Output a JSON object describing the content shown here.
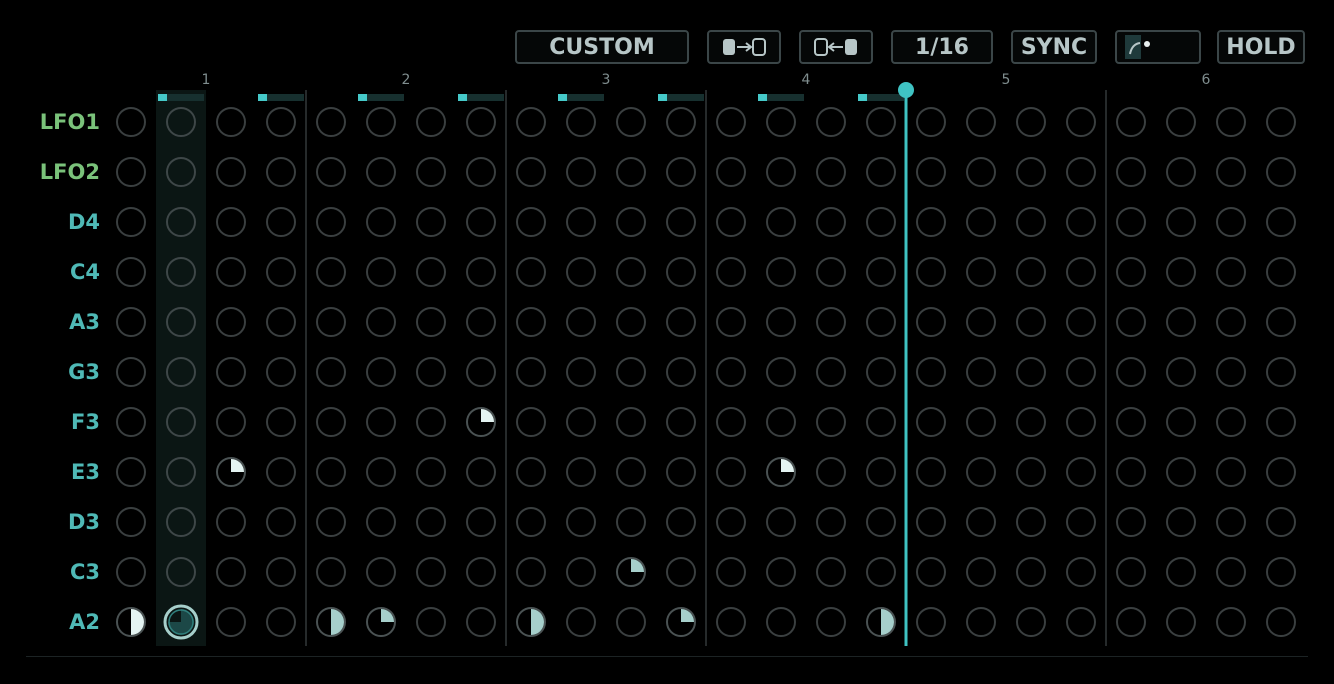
{
  "toolbar": {
    "mode_label": "CUSTOM",
    "shift_right_icon": "shift-right-icon",
    "shift_left_icon": "shift-left-icon",
    "rate_label": "1/16",
    "sync_label": "SYNC",
    "curve_icon": "curve-knob-icon",
    "hold_label": "HOLD"
  },
  "colors": {
    "background": "#000000",
    "lfo_label": "#7ac27a",
    "note_label": "#4fb9b6",
    "accent": "#45c9c9",
    "circle_stroke": "#3a3f40",
    "fill_light": "#e4f4f2",
    "fill_mid": "#a6cfcb",
    "fill_dark": "#1c4847",
    "bar_track": "#17302f",
    "playhead": "#3fc3c3"
  },
  "beats": [
    "1",
    "2",
    "3",
    "4",
    "5",
    "6"
  ],
  "rows": [
    {
      "label": "LFO1",
      "kind": "lfo"
    },
    {
      "label": "LFO2",
      "kind": "lfo"
    },
    {
      "label": "D4",
      "kind": "note"
    },
    {
      "label": "C4",
      "kind": "note"
    },
    {
      "label": "A3",
      "kind": "note"
    },
    {
      "label": "G3",
      "kind": "note"
    },
    {
      "label": "F3",
      "kind": "note"
    },
    {
      "label": "E3",
      "kind": "note"
    },
    {
      "label": "D3",
      "kind": "note"
    },
    {
      "label": "C3",
      "kind": "note"
    },
    {
      "label": "A2",
      "kind": "note"
    }
  ],
  "steps": 24,
  "selected_step": 1,
  "playhead_step": 15.5,
  "step_bars": [
    {
      "step": 1,
      "level": 0.2
    },
    {
      "step": 3,
      "level": 0.2
    },
    {
      "step": 5,
      "level": 0.2
    },
    {
      "step": 7,
      "level": 0.2
    },
    {
      "step": 9,
      "level": 0.2
    },
    {
      "step": 11,
      "level": 0.2
    },
    {
      "step": 13,
      "level": 0.2
    },
    {
      "step": 15,
      "level": 0.2
    }
  ],
  "cells": [
    {
      "row": 6,
      "step": 7,
      "fraction": 0.25,
      "style": "light"
    },
    {
      "row": 7,
      "step": 2,
      "fraction": 0.25,
      "style": "light"
    },
    {
      "row": 7,
      "step": 13,
      "fraction": 0.25,
      "style": "light"
    },
    {
      "row": 9,
      "step": 10,
      "fraction": 0.25,
      "style": "mid"
    },
    {
      "row": 10,
      "step": 0,
      "fraction": 0.5,
      "style": "light"
    },
    {
      "row": 10,
      "step": 1,
      "fraction": 0.75,
      "style": "dark",
      "selected": true
    },
    {
      "row": 10,
      "step": 4,
      "fraction": 0.5,
      "style": "mid"
    },
    {
      "row": 10,
      "step": 5,
      "fraction": 0.25,
      "style": "mid"
    },
    {
      "row": 10,
      "step": 8,
      "fraction": 0.5,
      "style": "mid"
    },
    {
      "row": 10,
      "step": 11,
      "fraction": 0.25,
      "style": "mid"
    },
    {
      "row": 10,
      "step": 15,
      "fraction": 0.5,
      "style": "mid"
    }
  ]
}
